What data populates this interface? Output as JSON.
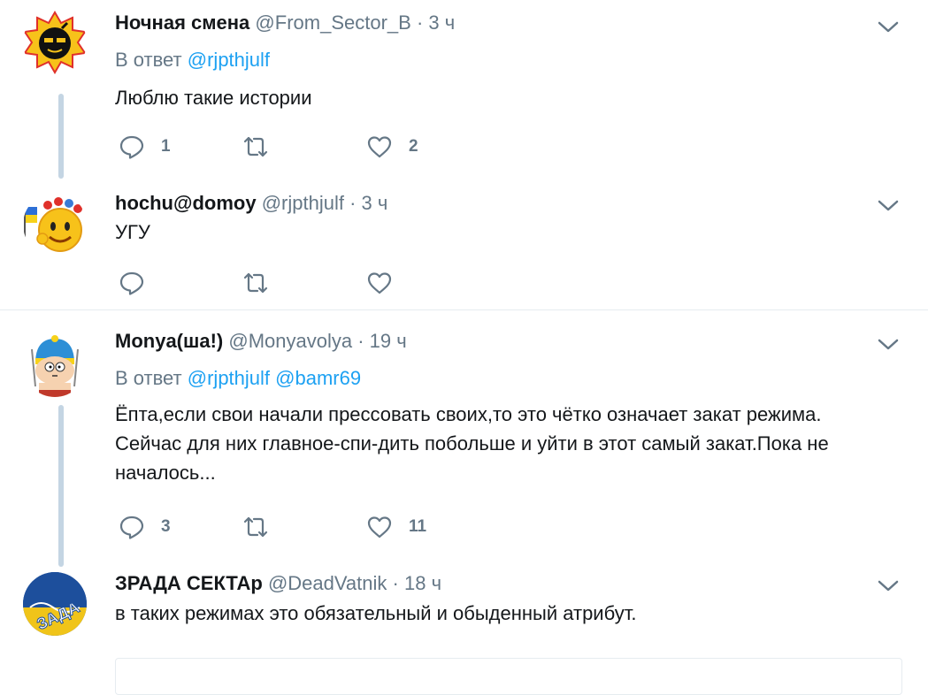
{
  "tweets": [
    {
      "name": "Ночная смена",
      "handle": "@From_Sector_B",
      "dot": "·",
      "time": "3 ч",
      "reply_prefix": "В ответ",
      "mentions": [
        "@rjpthjulf"
      ],
      "text": "Люблю такие истории",
      "reply_count": "1",
      "retweet_count": "",
      "like_count": "2"
    },
    {
      "name": "hochu@domoy",
      "handle": "@rjpthjulf",
      "dot": "·",
      "time": "3 ч",
      "text": "УГУ",
      "reply_count": "",
      "retweet_count": "",
      "like_count": ""
    },
    {
      "name": "Monya(ша!)",
      "handle": "@Monyavolya",
      "dot": "·",
      "time": "19 ч",
      "reply_prefix": "В ответ",
      "mentions": [
        "@rjpthjulf",
        "@bamr69"
      ],
      "text_lines": [
        "Ёпта,если свои начали прессовать своих,то это чётко означает закат режима.",
        "Сейчас для них главное-спи-дить побольше и уйти в этот самый закат.Пока не",
        "началось..."
      ],
      "reply_count": "3",
      "retweet_count": "",
      "like_count": "11"
    },
    {
      "name": "ЗРАДА СЕКТАр",
      "handle": "@DeadVatnik",
      "dot": "·",
      "time": "18 ч",
      "text": "в таких режимах это обязательный и обыденный атрибут."
    }
  ],
  "icons": {
    "reply": "reply-icon",
    "retweet": "retweet-icon",
    "like": "heart-icon",
    "more": "chevron-down-icon"
  },
  "colors": {
    "link": "#1da1f2",
    "muted": "#657786",
    "thread_line": "#c4d5e3"
  }
}
